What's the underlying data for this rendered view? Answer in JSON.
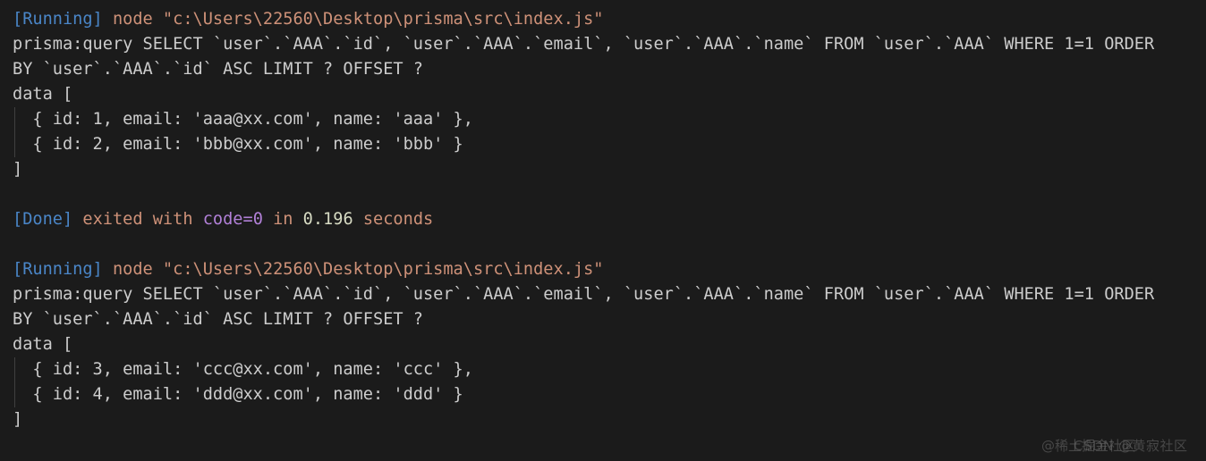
{
  "terminal": {
    "background_color": "#1b1b1b",
    "colors": {
      "tag": "#4a86c8",
      "string": "#ce9178",
      "plain": "#cccccc",
      "purple": "#b180d7",
      "number": "#d7dbc3",
      "indent_guide": "#404040"
    },
    "lines": [
      {
        "id": "run-1-header",
        "name": "running-header-line",
        "segments": [
          {
            "text": "[Running] ",
            "style": "tag"
          },
          {
            "text": "node \"c:\\Users\\22560\\Desktop\\prisma\\src\\index.js\"",
            "style": "string"
          }
        ]
      },
      {
        "id": "run-1-query-a",
        "name": "prisma-query-line",
        "segments": [
          {
            "text": "prisma:query SELECT `user`.`AAA`.`id`, `user`.`AAA`.`email`, `user`.`AAA`.`name` FROM `user`.`AAA` WHERE 1=1 ORDER",
            "style": "plain"
          }
        ]
      },
      {
        "id": "run-1-query-b",
        "name": "prisma-query-wrap-line",
        "segments": [
          {
            "text": "BY `user`.`AAA`.`id` ASC LIMIT ? OFFSET ?",
            "style": "plain"
          }
        ]
      },
      {
        "id": "run-1-data-open",
        "name": "data-array-open-line",
        "segments": [
          {
            "text": "data [",
            "style": "plain"
          }
        ]
      },
      {
        "id": "run-1-row-1",
        "name": "data-row-line",
        "indent_guide": true,
        "segments": [
          {
            "text": "  { id: 1, email: 'aaa@xx.com', name: 'aaa' },",
            "style": "plain"
          }
        ]
      },
      {
        "id": "run-1-row-2",
        "name": "data-row-line",
        "indent_guide": true,
        "segments": [
          {
            "text": "  { id: 2, email: 'bbb@xx.com', name: 'bbb' }",
            "style": "plain"
          }
        ]
      },
      {
        "id": "run-1-data-close",
        "name": "data-array-close-line",
        "segments": [
          {
            "text": "]",
            "style": "plain"
          }
        ]
      },
      {
        "id": "blank-1",
        "name": "blank-line",
        "blank": true,
        "segments": [
          {
            "text": " ",
            "style": "plain"
          }
        ]
      },
      {
        "id": "done-1",
        "name": "done-status-line",
        "segments": [
          {
            "text": "[Done] ",
            "style": "tag"
          },
          {
            "text": "exited with ",
            "style": "string"
          },
          {
            "text": "code=0",
            "style": "purple"
          },
          {
            "text": " in ",
            "style": "string"
          },
          {
            "text": "0.196",
            "style": "number"
          },
          {
            "text": " seconds",
            "style": "string"
          }
        ]
      },
      {
        "id": "blank-2",
        "name": "blank-line",
        "blank": true,
        "segments": [
          {
            "text": " ",
            "style": "plain"
          }
        ]
      },
      {
        "id": "run-2-header",
        "name": "running-header-line",
        "segments": [
          {
            "text": "[Running] ",
            "style": "tag"
          },
          {
            "text": "node \"c:\\Users\\22560\\Desktop\\prisma\\src\\index.js\"",
            "style": "string"
          }
        ]
      },
      {
        "id": "run-2-query-a",
        "name": "prisma-query-line",
        "segments": [
          {
            "text": "prisma:query SELECT `user`.`AAA`.`id`, `user`.`AAA`.`email`, `user`.`AAA`.`name` FROM `user`.`AAA` WHERE 1=1 ORDER",
            "style": "plain"
          }
        ]
      },
      {
        "id": "run-2-query-b",
        "name": "prisma-query-wrap-line",
        "segments": [
          {
            "text": "BY `user`.`AAA`.`id` ASC LIMIT ? OFFSET ?",
            "style": "plain"
          }
        ]
      },
      {
        "id": "run-2-data-open",
        "name": "data-array-open-line",
        "segments": [
          {
            "text": "data [",
            "style": "plain"
          }
        ]
      },
      {
        "id": "run-2-row-1",
        "name": "data-row-line",
        "indent_guide": true,
        "segments": [
          {
            "text": "  { id: 3, email: 'ccc@xx.com', name: 'ccc' },",
            "style": "plain"
          }
        ]
      },
      {
        "id": "run-2-row-2",
        "name": "data-row-line",
        "indent_guide": true,
        "segments": [
          {
            "text": "  { id: 4, email: 'ddd@xx.com', name: 'ddd' }",
            "style": "plain"
          }
        ]
      },
      {
        "id": "run-2-data-close",
        "name": "data-array-close-line",
        "segments": [
          {
            "text": "]",
            "style": "plain"
          }
        ]
      }
    ],
    "records": [
      {
        "id": 1,
        "email": "aaa@xx.com",
        "name": "aaa"
      },
      {
        "id": 2,
        "email": "bbb@xx.com",
        "name": "bbb"
      },
      {
        "id": 3,
        "email": "ccc@xx.com",
        "name": "ccc"
      },
      {
        "id": 4,
        "email": "ddd@xx.com",
        "name": "ddd"
      }
    ],
    "exit": {
      "code": "code=0",
      "duration": "0.196",
      "unit": "seconds"
    },
    "script_path": "c:\\Users\\22560\\Desktop\\prisma\\src\\index.js"
  },
  "watermark": {
    "text_a": "@稀土掘金社区",
    "text_b": "CSDN @黄寂社区"
  }
}
